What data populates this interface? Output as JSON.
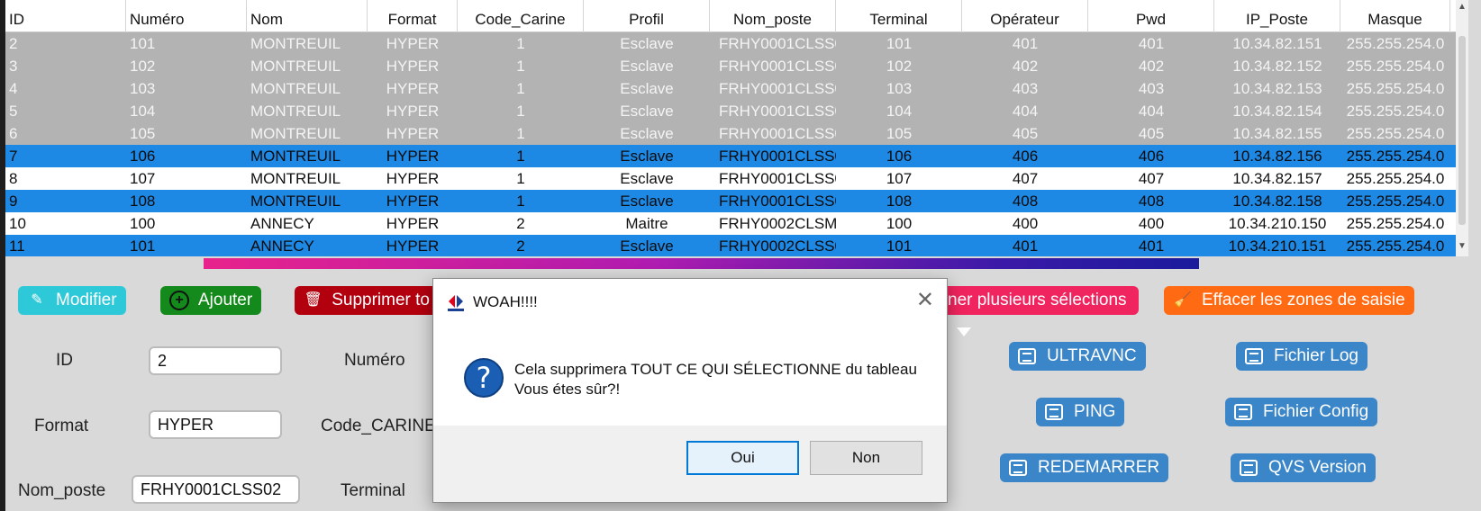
{
  "table": {
    "headers": [
      "ID",
      "Numéro",
      "Nom",
      "Format",
      "Code_Carine",
      "Profil",
      "Nom_poste",
      "Terminal",
      "Opérateur",
      "Pwd",
      "IP_Poste",
      "Masque"
    ],
    "rows": [
      {
        "style": "grey",
        "cells": [
          "2",
          "101",
          "MONTREUIL",
          "HYPER",
          "1",
          "Esclave",
          "FRHY0001CLSS0",
          "101",
          "401",
          "401",
          "10.34.82.151",
          "255.255.254.0"
        ]
      },
      {
        "style": "grey",
        "cells": [
          "3",
          "102",
          "MONTREUIL",
          "HYPER",
          "1",
          "Esclave",
          "FRHY0001CLSS0",
          "102",
          "402",
          "402",
          "10.34.82.152",
          "255.255.254.0"
        ]
      },
      {
        "style": "grey",
        "cells": [
          "4",
          "103",
          "MONTREUIL",
          "HYPER",
          "1",
          "Esclave",
          "FRHY0001CLSS0",
          "103",
          "403",
          "403",
          "10.34.82.153",
          "255.255.254.0"
        ]
      },
      {
        "style": "grey",
        "cells": [
          "5",
          "104",
          "MONTREUIL",
          "HYPER",
          "1",
          "Esclave",
          "FRHY0001CLSS0",
          "104",
          "404",
          "404",
          "10.34.82.154",
          "255.255.254.0"
        ]
      },
      {
        "style": "grey",
        "cells": [
          "6",
          "105",
          "MONTREUIL",
          "HYPER",
          "1",
          "Esclave",
          "FRHY0001CLSS0",
          "105",
          "405",
          "405",
          "10.34.82.155",
          "255.255.254.0"
        ]
      },
      {
        "style": "blue",
        "cells": [
          "7",
          "106",
          "MONTREUIL",
          "HYPER",
          "1",
          "Esclave",
          "FRHY0001CLSS0",
          "106",
          "406",
          "406",
          "10.34.82.156",
          "255.255.254.0"
        ]
      },
      {
        "style": "white",
        "cells": [
          "8",
          "107",
          "MONTREUIL",
          "HYPER",
          "1",
          "Esclave",
          "FRHY0001CLSS0",
          "107",
          "407",
          "407",
          "10.34.82.157",
          "255.255.254.0"
        ]
      },
      {
        "style": "blue",
        "cells": [
          "9",
          "108",
          "MONTREUIL",
          "HYPER",
          "1",
          "Esclave",
          "FRHY0001CLSS0",
          "108",
          "408",
          "408",
          "10.34.82.158",
          "255.255.254.0"
        ]
      },
      {
        "style": "white",
        "cells": [
          "10",
          "100",
          "ANNECY",
          "HYPER",
          "2",
          "Maitre",
          "FRHY0002CLSM(",
          "100",
          "400",
          "400",
          "10.34.210.150",
          "255.255.254.0"
        ]
      },
      {
        "style": "blue",
        "cells": [
          "11",
          "101",
          "ANNECY",
          "HYPER",
          "2",
          "Esclave",
          "FRHY0002CLSS0",
          "101",
          "401",
          "401",
          "10.34.210.151",
          "255.255.254.0"
        ]
      }
    ]
  },
  "actions": {
    "modifier": "Modifier",
    "ajouter": "Ajouter",
    "supprimer": "Supprimer to",
    "plusieurs": "ner plusieurs sélections",
    "effacer": "Effacer les zones de saisie"
  },
  "form": {
    "id_label": "ID",
    "id_value": "2",
    "numero_label": "Numéro",
    "format_label": "Format",
    "format_value": "HYPER",
    "code_label": "Code_CARINE",
    "nomposte_label": "Nom_poste",
    "nomposte_value": "FRHY0001CLSS02",
    "terminal_label": "Terminal"
  },
  "tools": {
    "ultravnc": "ULTRAVNC",
    "fichier_log": "Fichier Log",
    "ping": "PING",
    "fichier_config": "Fichier Config",
    "redemarrer": "REDEMARRER",
    "qvs_version": "QVS Version"
  },
  "dialog": {
    "title": "WOAH!!!!",
    "icon": "question-icon",
    "message": "Cela supprimera TOUT CE QUI SÉLECTIONNE du tableau\n Vous étes sûr?!",
    "yes": "Oui",
    "no": "Non"
  },
  "colors": {
    "selected_row": "#1e88e5",
    "grey_row": "#b3b3b3",
    "modifier": "#2ec9d8",
    "ajouter": "#138a1b",
    "supprimer": "#b3000f",
    "plusieurs": "#f0245e",
    "effacer": "#ff6a13",
    "tool": "#3a86c8"
  }
}
